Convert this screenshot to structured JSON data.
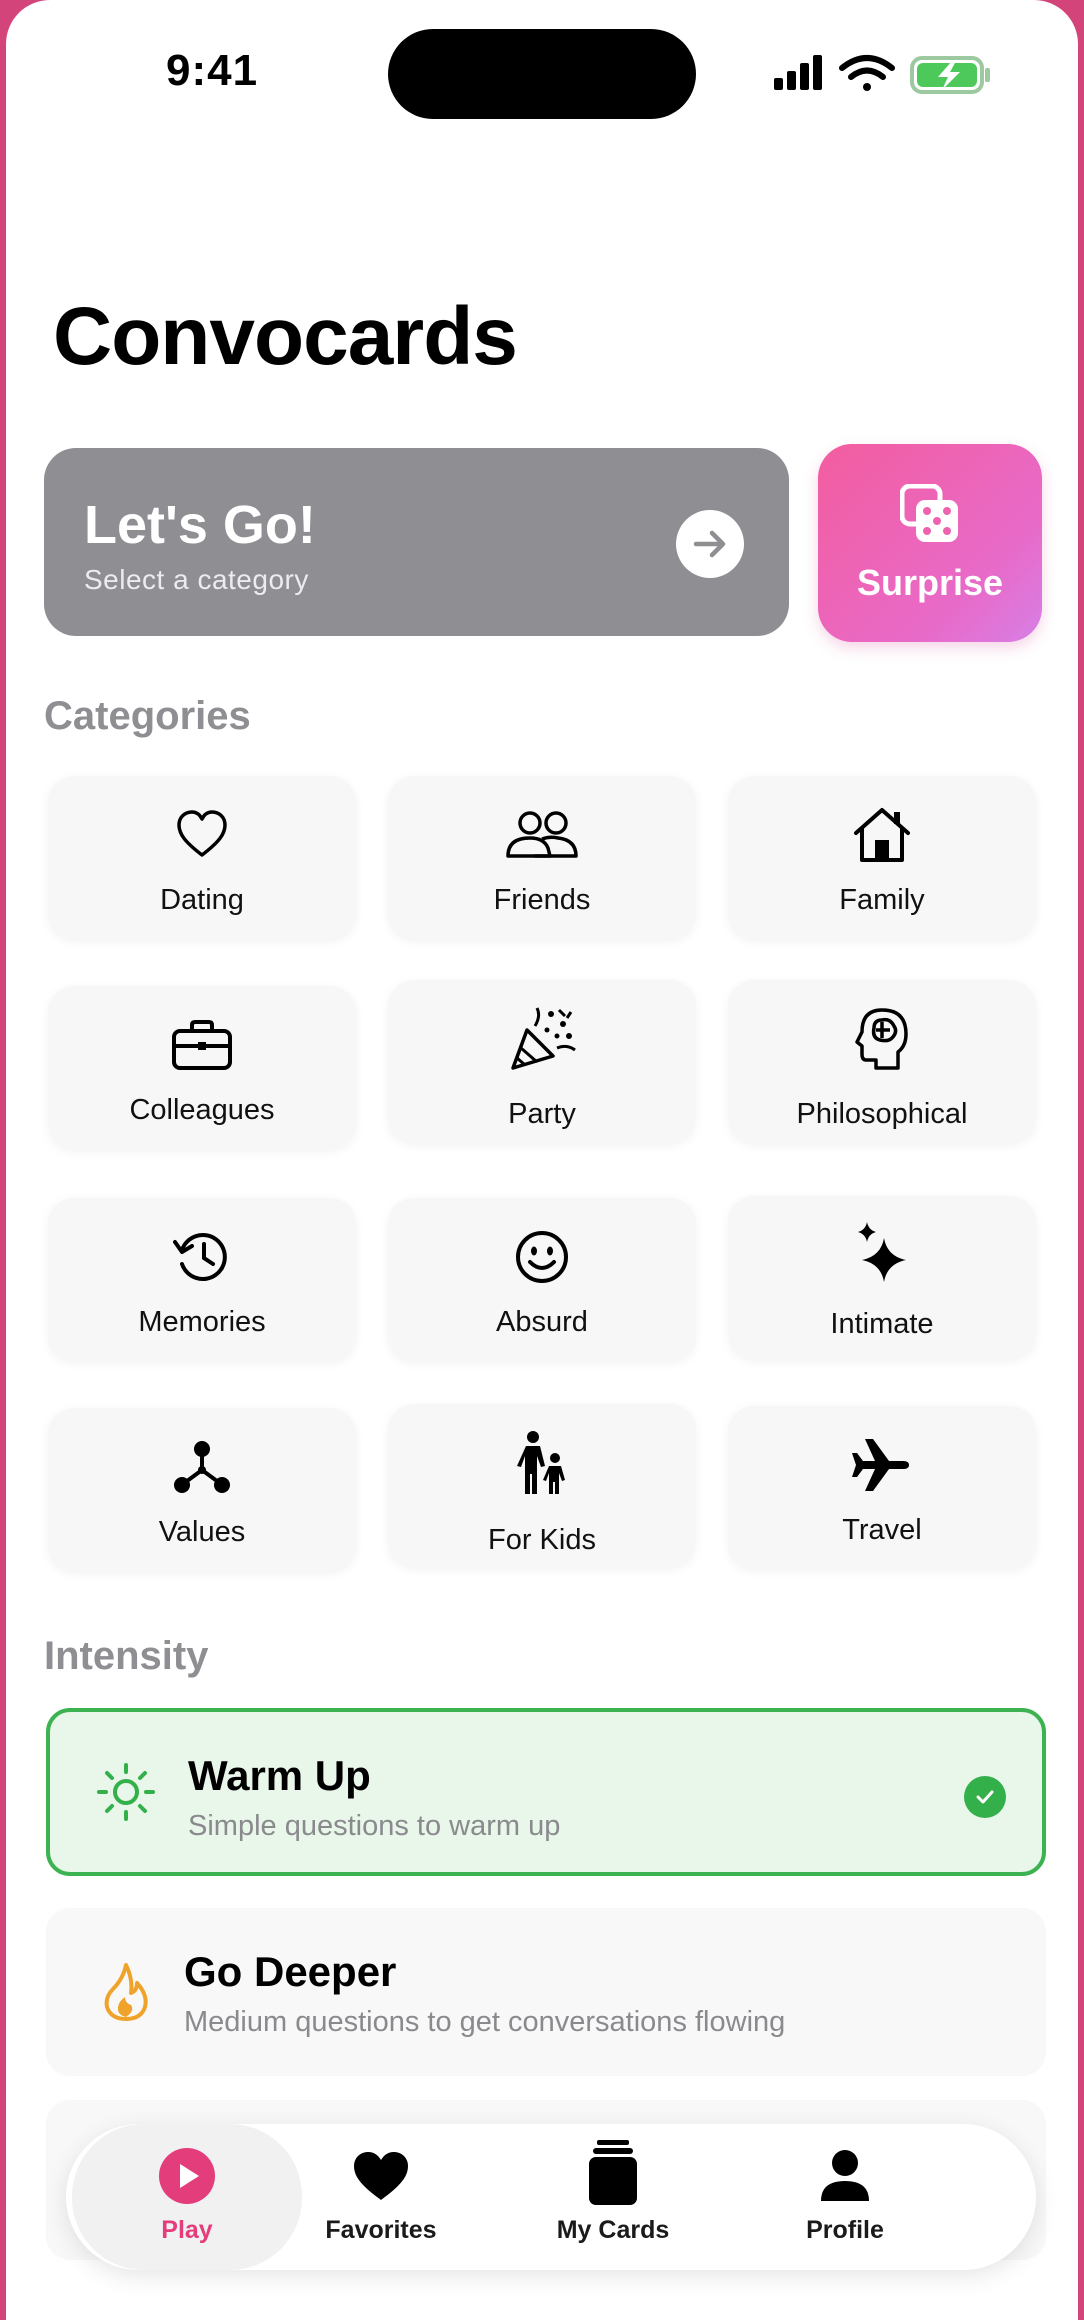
{
  "status_bar": {
    "time": "9:41"
  },
  "app": {
    "title": "Convocards"
  },
  "hero": {
    "title": "Let's Go!",
    "subtitle": "Select a category",
    "surprise_label": "Surprise"
  },
  "categories": {
    "header": "Categories",
    "items": [
      {
        "label": "Dating",
        "icon": "heart-icon"
      },
      {
        "label": "Friends",
        "icon": "people-icon"
      },
      {
        "label": "Family",
        "icon": "house-icon"
      },
      {
        "label": "Colleagues",
        "icon": "briefcase-icon"
      },
      {
        "label": "Party",
        "icon": "party-popper-icon"
      },
      {
        "label": "Philosophical",
        "icon": "brain-head-icon"
      },
      {
        "label": "Memories",
        "icon": "history-clock-icon"
      },
      {
        "label": "Absurd",
        "icon": "smiley-icon"
      },
      {
        "label": "Intimate",
        "icon": "sparkles-icon"
      },
      {
        "label": "Values",
        "icon": "molecule-icon"
      },
      {
        "label": "For Kids",
        "icon": "parent-child-icon"
      },
      {
        "label": "Travel",
        "icon": "airplane-icon"
      }
    ]
  },
  "intensity": {
    "header": "Intensity",
    "options": [
      {
        "title": "Warm Up",
        "subtitle": "Simple questions to warm up",
        "selected": true,
        "icon": "sun-icon",
        "color": "#34b04a"
      },
      {
        "title": "Go Deeper",
        "subtitle": "Medium questions to get conversations flowing",
        "selected": false,
        "icon": "flame-icon",
        "color": "#f0a32a"
      }
    ]
  },
  "tab_bar": {
    "tabs": [
      {
        "label": "Play",
        "icon": "play-icon",
        "active": true
      },
      {
        "label": "Favorites",
        "icon": "heart-filled-icon",
        "active": false
      },
      {
        "label": "My Cards",
        "icon": "cards-stack-icon",
        "active": false
      },
      {
        "label": "Profile",
        "icon": "person-icon",
        "active": false
      }
    ],
    "accent": "#e33d7b"
  }
}
